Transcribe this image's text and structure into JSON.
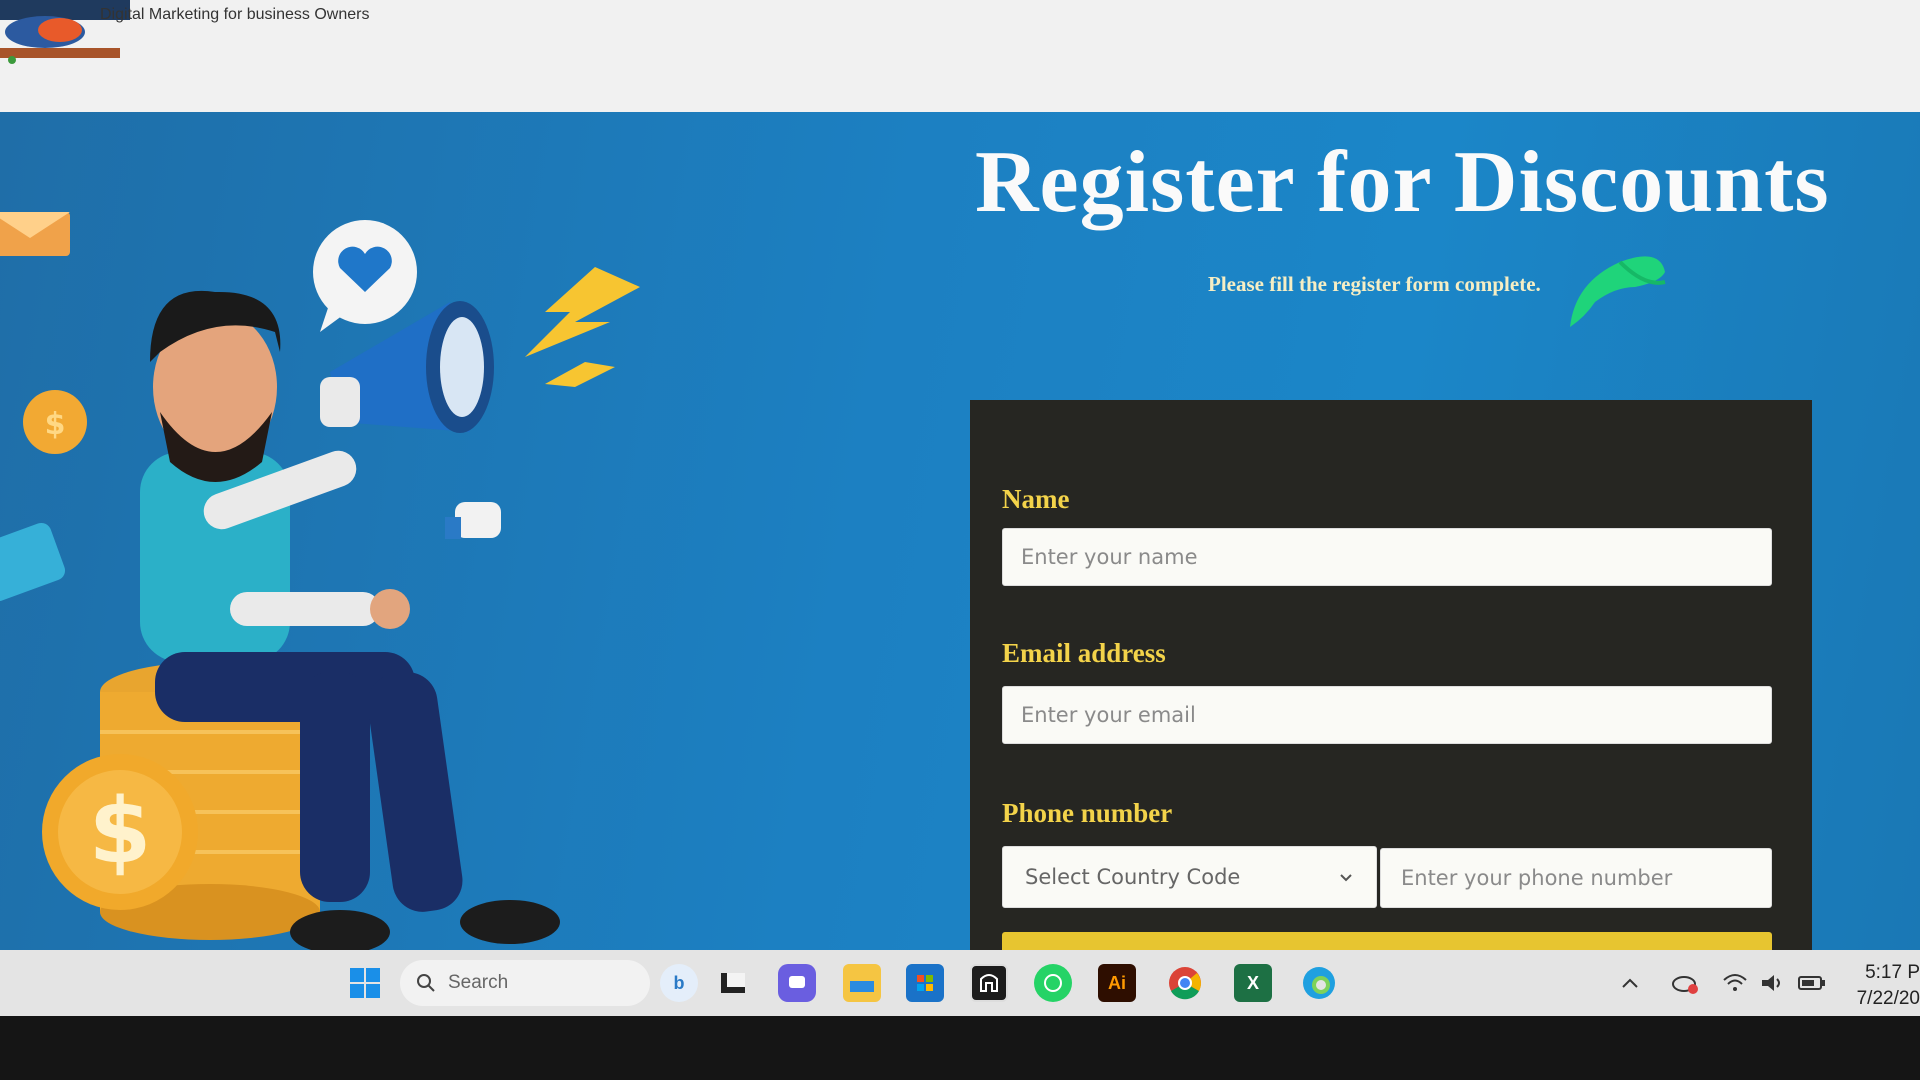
{
  "header": {
    "logo_alt": "Digital Marketing for business Owners",
    "tagline": "Digital Marketing for business Owners"
  },
  "hero": {
    "title": "Register for Discounts",
    "subtitle": "Please fill the register form complete."
  },
  "form": {
    "name_label": "Name",
    "name_placeholder": "Enter your name",
    "email_label": "Email address",
    "email_placeholder": "Enter your email",
    "phone_label": "Phone number",
    "country_code_placeholder": "Select Country Code",
    "phone_placeholder": "Enter your phone number"
  },
  "taskbar": {
    "search_placeholder": "Search",
    "apps": [
      "bing-icon",
      "terminal-icon",
      "chat-icon",
      "file-explorer-icon",
      "store-icon",
      "app-icon",
      "whatsapp-icon",
      "illustrator-icon",
      "chrome-icon",
      "excel-icon",
      "edge-icon"
    ],
    "illustrator_label": "Ai",
    "excel_label": "X",
    "time": "5:17 P",
    "date": "7/22/20"
  },
  "colors": {
    "hero_bg": "#1c80c2",
    "form_bg": "#262622",
    "label_yellow": "#f3d34a",
    "submit_yellow": "#e7c530"
  }
}
